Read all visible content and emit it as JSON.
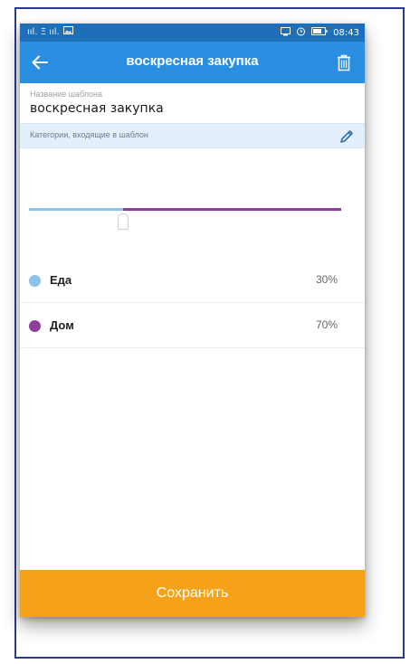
{
  "status_bar": {
    "left_text": "ııl. Ξ ııl.",
    "time": "08:43",
    "icons": [
      "signal-icon",
      "gallery-icon",
      "cast-icon",
      "alarm-icon",
      "battery-icon"
    ]
  },
  "header": {
    "title": "воскресная закупка",
    "back_icon": "arrow-left-icon",
    "delete_icon": "trash-icon",
    "background": "#2a8fe0"
  },
  "template_name": {
    "label": "Название шаблона",
    "value": "воскресная закупка"
  },
  "categories_bar": {
    "label": "Категории, входящие в шаблон",
    "edit_icon": "pencil-icon"
  },
  "slider": {
    "value_fraction": 0.3,
    "left_color": "#8cc3e8",
    "right_color": "#8e3f9a"
  },
  "categories": [
    {
      "name": "Еда",
      "percent": "30%",
      "color": "#8cc3e8"
    },
    {
      "name": "Дом",
      "percent": "70%",
      "color": "#8e3f9a"
    }
  ],
  "footer": {
    "save_label": "Сохранить",
    "background": "#f5a21a"
  },
  "colors": {
    "status_bar": "#1e6fb8",
    "accent": "#2a8fe0",
    "save": "#f5a21a"
  }
}
